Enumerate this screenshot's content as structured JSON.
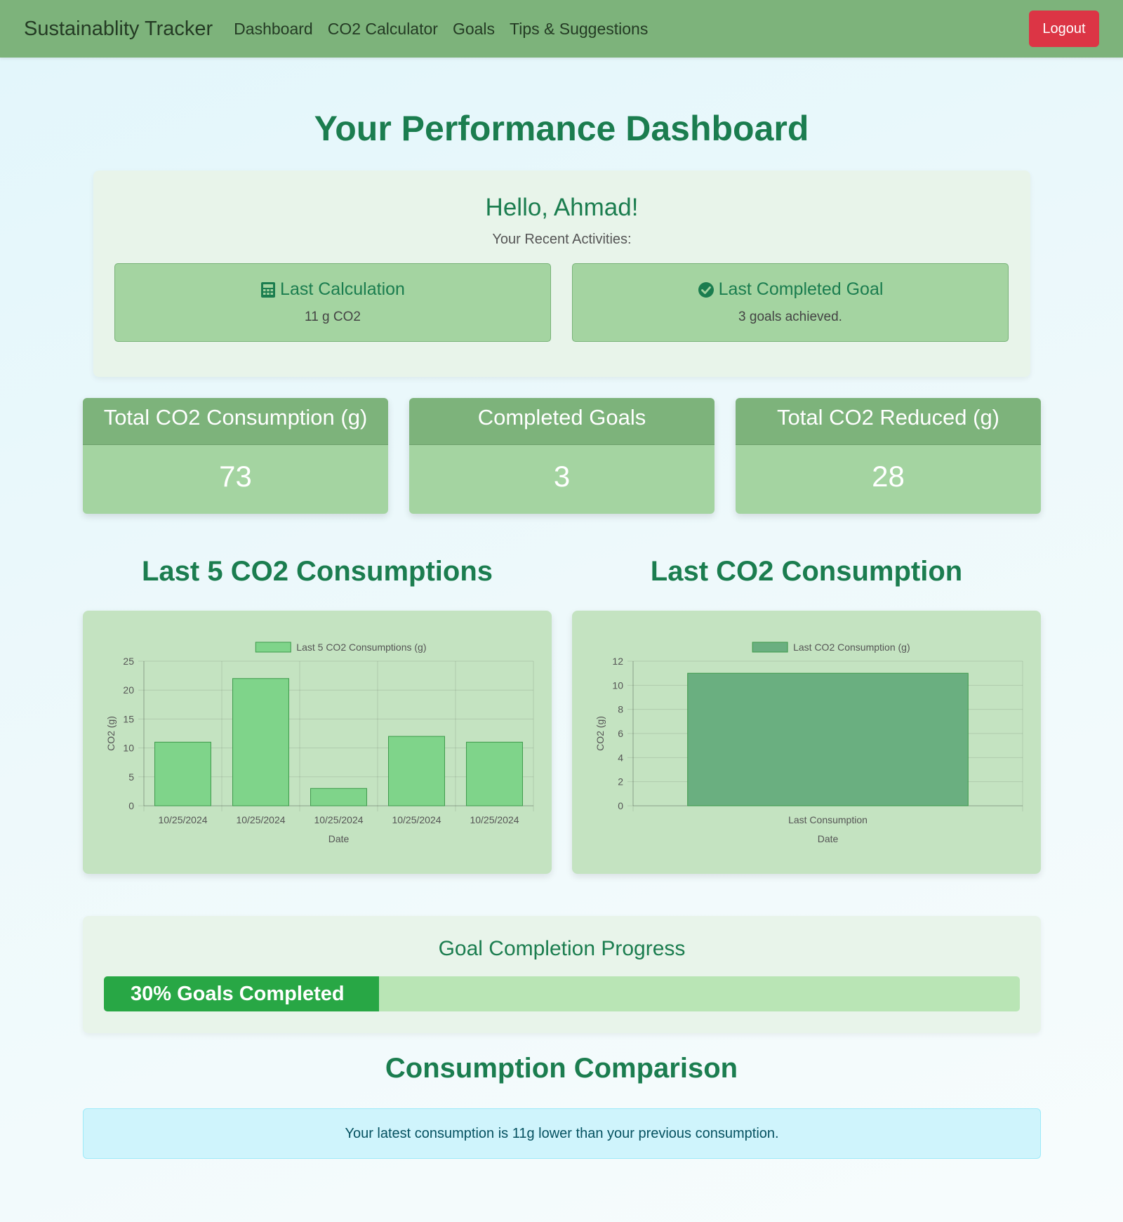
{
  "nav": {
    "brand": "Sustainablity Tracker",
    "links": [
      "Dashboard",
      "CO2 Calculator",
      "Goals",
      "Tips & Suggestions"
    ],
    "logout": "Logout"
  },
  "page_title": "Your Performance Dashboard",
  "welcome": {
    "greeting": "Hello, Ahmad!",
    "subtitle": "Your Recent Activities:",
    "last_calc": {
      "title": "Last Calculation",
      "value": "11 g CO2",
      "icon": "calculator-icon"
    },
    "last_goal": {
      "title": "Last Completed Goal",
      "value": "3 goals achieved.",
      "icon": "check-circle-icon"
    }
  },
  "stats": [
    {
      "label": "Total CO2 Consumption (g)",
      "value": "73"
    },
    {
      "label": "Completed Goals",
      "value": "3"
    },
    {
      "label": "Total CO2 Reduced (g)",
      "value": "28"
    }
  ],
  "charts": {
    "left_title": "Last 5 CO2 Consumptions",
    "right_title": "Last CO2 Consumption"
  },
  "chart_data": [
    {
      "type": "bar",
      "legend": "Last 5 CO2 Consumptions (g)",
      "categories": [
        "10/25/2024",
        "10/25/2024",
        "10/25/2024",
        "10/25/2024",
        "10/25/2024"
      ],
      "values": [
        11,
        22,
        3,
        12,
        11
      ],
      "xlabel": "Date",
      "ylabel": "CO2 (g)",
      "ylim": [
        0,
        25
      ],
      "yticks": [
        0,
        5,
        10,
        15,
        20,
        25
      ],
      "grid": true,
      "color": "#7fd48a",
      "border": "#3c9a4a"
    },
    {
      "type": "bar",
      "legend": "Last CO2 Consumption (g)",
      "categories": [
        "Last Consumption"
      ],
      "values": [
        11
      ],
      "xlabel": "Date",
      "ylabel": "CO2 (g)",
      "ylim": [
        0,
        12
      ],
      "yticks": [
        0,
        2,
        4,
        6,
        8,
        10,
        12
      ],
      "grid": true,
      "color": "#6aaf80",
      "border": "#3c9a4a"
    }
  ],
  "progress": {
    "title": "Goal Completion Progress",
    "label": "30% Goals Completed",
    "percent": 30
  },
  "comparison": {
    "title": "Consumption Comparison",
    "message": "Your latest consumption is 11g lower than your previous consumption."
  }
}
